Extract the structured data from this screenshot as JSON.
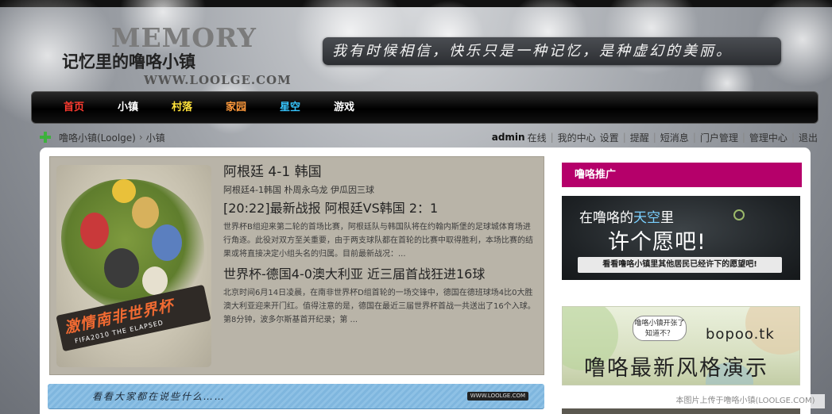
{
  "colors": {
    "promo_accent": "#b5006a",
    "nav_bg": "#000000"
  },
  "header": {
    "logo": {
      "word": "MEMORY",
      "title": "记忆里的噜咯小镇",
      "url": "WWW.LOOLGE.COM"
    },
    "slogan": "我有时候相信，快乐只是一种记忆，是种虚幻的美丽。"
  },
  "nav": [
    {
      "label": "首页",
      "color": "#ff3b30"
    },
    {
      "label": "小镇",
      "color": "#ffffff"
    },
    {
      "label": "村落",
      "color": "#ffe23a"
    },
    {
      "label": "家园",
      "color": "#ff9a3c"
    },
    {
      "label": "星空",
      "color": "#37c6ff"
    },
    {
      "label": "游戏",
      "color": "#ffffff"
    }
  ],
  "breadcrumb": {
    "home": "噜咯小镇(Loolge)",
    "separator": "›",
    "current": "小镇"
  },
  "userbar": {
    "username": "admin",
    "status": "在线",
    "my_center": "我的中心",
    "settings": "设置",
    "remind": "提醒",
    "messages": "短消息",
    "portal_admin": "门户管理",
    "admin_center": "管理中心",
    "logout": "退出"
  },
  "feature": {
    "image_text": "激情南非世界杯",
    "image_subtext": "FIFA2010 THE ELAPSED",
    "headline": "阿根廷 4-1 韩国",
    "tags": "阿根廷4-1韩国 朴周永乌龙 伊瓜因三球",
    "article1_title": "[20:22]最新战报 阿根廷VS韩国 2：1",
    "article1_summary": "世界杯B组迎来第二轮的首场比赛，阿根廷队与韩国队将在约翰内斯堡的足球城体育场进行角逐。此役对双方至关重要，由于两支球队都在首轮的比赛中取得胜利，本场比赛的结果或将直接决定小组头名的归属。目前最新战况：...",
    "article2_title": "世界杯-德国4-0澳大利亚 近三届首战狂进16球",
    "article2_summary": "北京时间6月14日凌晨，在南非世界杯D组首轮的一场交锋中，德国在德班球场4比0大胜澳大利亚迎来开门红。值得注意的是，德国在最近三届世界杯首战一共送出了16个入球。第8分钟，波多尔斯基首开纪录；第 ..."
  },
  "chat_bar": {
    "label": "看看大家都在说些什么……",
    "mark": "WWW.LOOLGE.COM"
  },
  "promo": {
    "title": "噜咯推广",
    "ad1": {
      "line1_prefix": "在噜咯的",
      "line1_highlight": "天空",
      "line1_suffix": "里",
      "line2": "许个愿吧!",
      "button": "看看噜咯小镇里其他居民已经许下的愿望吧!"
    },
    "ad2": {
      "bubble_line1": "噜咯小镇开张了",
      "bubble_line2": "知道不？",
      "site": "bopoo.tk",
      "big": "噜咯最新风格演示"
    }
  },
  "credit": "本图片上传于噜咯小镇(LOOLGE.COM)"
}
